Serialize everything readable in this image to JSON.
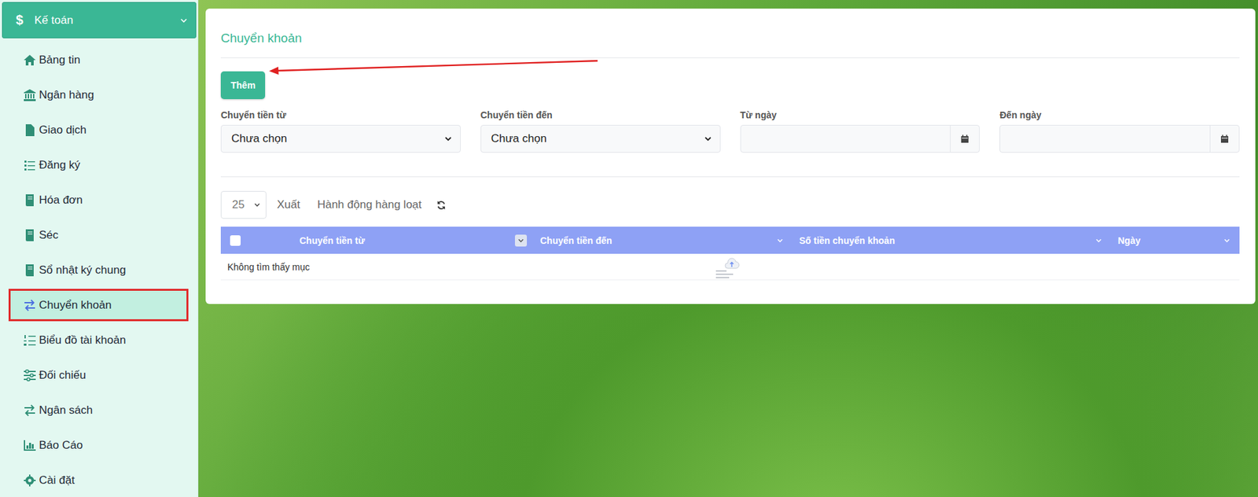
{
  "sidebar": {
    "header": {
      "icon": "$",
      "label": "Kế toán",
      "expanded": true
    },
    "items": [
      {
        "label": "Bảng tin",
        "selected": false
      },
      {
        "label": "Ngân hàng",
        "selected": false
      },
      {
        "label": "Giao dịch",
        "selected": false
      },
      {
        "label": "Đăng ký",
        "selected": false
      },
      {
        "label": "Hóa đơn",
        "selected": false
      },
      {
        "label": "Séc",
        "selected": false
      },
      {
        "label": "Sổ nhật ký chung",
        "selected": false
      },
      {
        "label": "Chuyển khoản",
        "selected": true
      },
      {
        "label": "Biểu đồ tài khoản",
        "selected": false
      },
      {
        "label": "Đối chiếu",
        "selected": false
      },
      {
        "label": "Ngân sách",
        "selected": false
      },
      {
        "label": "Báo Cáo",
        "selected": false
      },
      {
        "label": "Cài đặt",
        "selected": false
      }
    ]
  },
  "page": {
    "title": "Chuyển khoản",
    "add_button": "Thêm",
    "filters": [
      {
        "label": "Chuyển tiền từ",
        "kind": "select",
        "value": "Chưa chọn"
      },
      {
        "label": "Chuyển tiền đến",
        "kind": "select",
        "value": "Chưa chọn"
      },
      {
        "label": "Từ ngày",
        "kind": "date",
        "value": ""
      },
      {
        "label": "Đến ngày",
        "kind": "date",
        "value": ""
      }
    ],
    "toolbar": {
      "page_size": "25",
      "export": "Xuất",
      "bulk_actions": "Hành động hàng loạt"
    },
    "table": {
      "columns": [
        "Chuyển tiền từ",
        "Chuyển tiền đến",
        "Số tiền chuyển khoản",
        "Ngày"
      ],
      "rows": [],
      "empty_message": "Không tìm thấy mục"
    }
  }
}
